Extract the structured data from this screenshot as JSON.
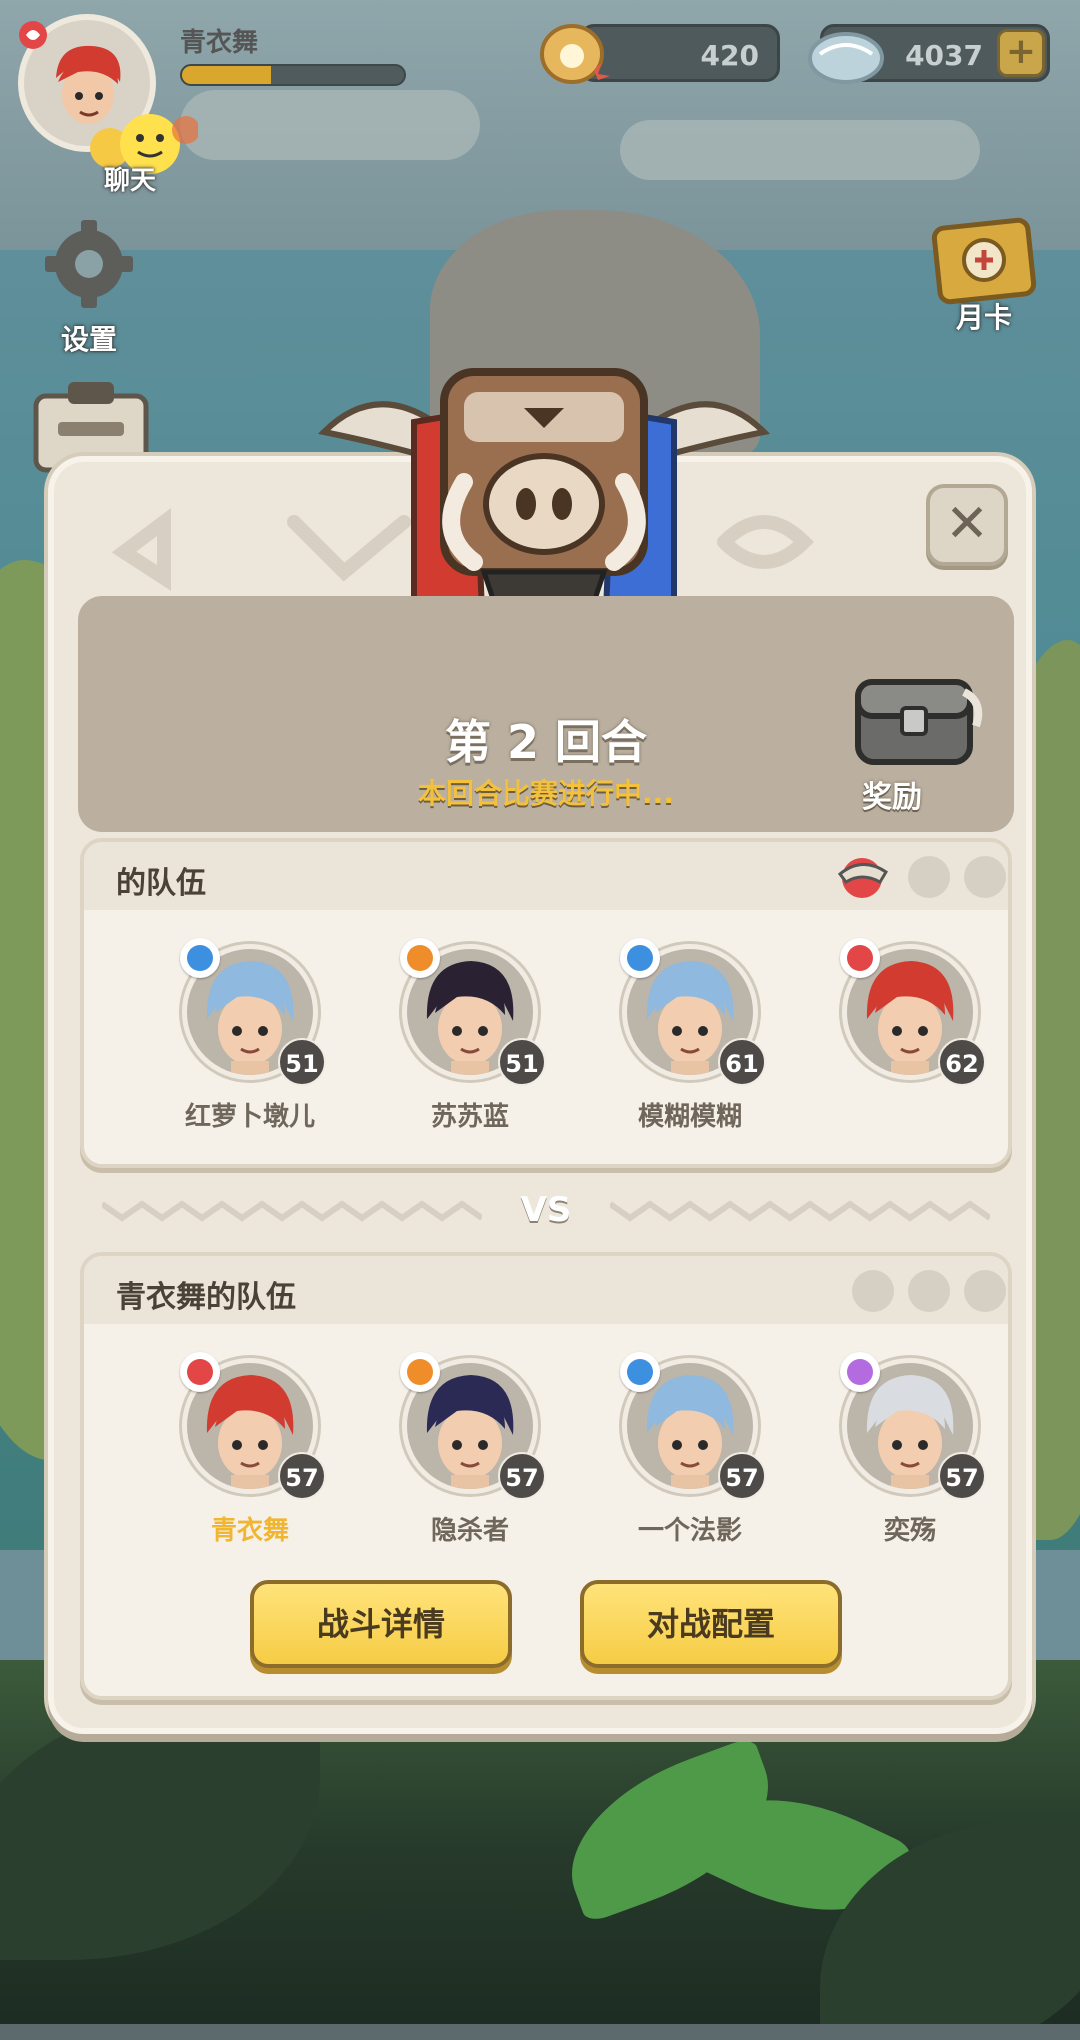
{
  "hud": {
    "player_name": "青衣舞",
    "exp_fraction": 0.4,
    "chat_label": "聊天",
    "currency_shell": "420",
    "currency_gem": "4037",
    "settings_label": "设置",
    "month_card_label": "月卡"
  },
  "modal": {
    "round_title": "第 2 回合",
    "round_status": "本回合比赛进行中...",
    "reward_label": "奖励",
    "vs_label": "VS",
    "team_a": {
      "title": "的队伍",
      "members": [
        {
          "name": "红萝卜墩儿",
          "level": "51",
          "hair": "#8fb9de",
          "badge": "#3d8fe0"
        },
        {
          "name": "苏苏蓝",
          "level": "51",
          "hair": "#2a2233",
          "badge": "#ef8d2a"
        },
        {
          "name": "模糊模糊",
          "level": "61",
          "hair": "#8fb9de",
          "badge": "#3d8fe0"
        },
        {
          "name": "",
          "level": "62",
          "hair": "#d23b2f",
          "badge": "#e34646"
        }
      ]
    },
    "team_b": {
      "title": "青衣舞的队伍",
      "members": [
        {
          "name": "青衣舞",
          "level": "57",
          "hair": "#d23b2f",
          "badge": "#e34646"
        },
        {
          "name": "隐杀者",
          "level": "57",
          "hair": "#2b2a55",
          "badge": "#ef8d2a"
        },
        {
          "name": "一个法影",
          "level": "57",
          "hair": "#8fb9de",
          "badge": "#3d8fe0"
        },
        {
          "name": "奕殇",
          "level": "57",
          "hair": "#d9dde2",
          "badge": "#b46be0"
        }
      ]
    },
    "battle_detail_btn": "战斗详情",
    "battle_config_btn": "对战配置"
  },
  "colors": {
    "accent_yellow": "#f6cc45",
    "status_yellow": "#f3c13e",
    "self_name": "#f0b632"
  }
}
